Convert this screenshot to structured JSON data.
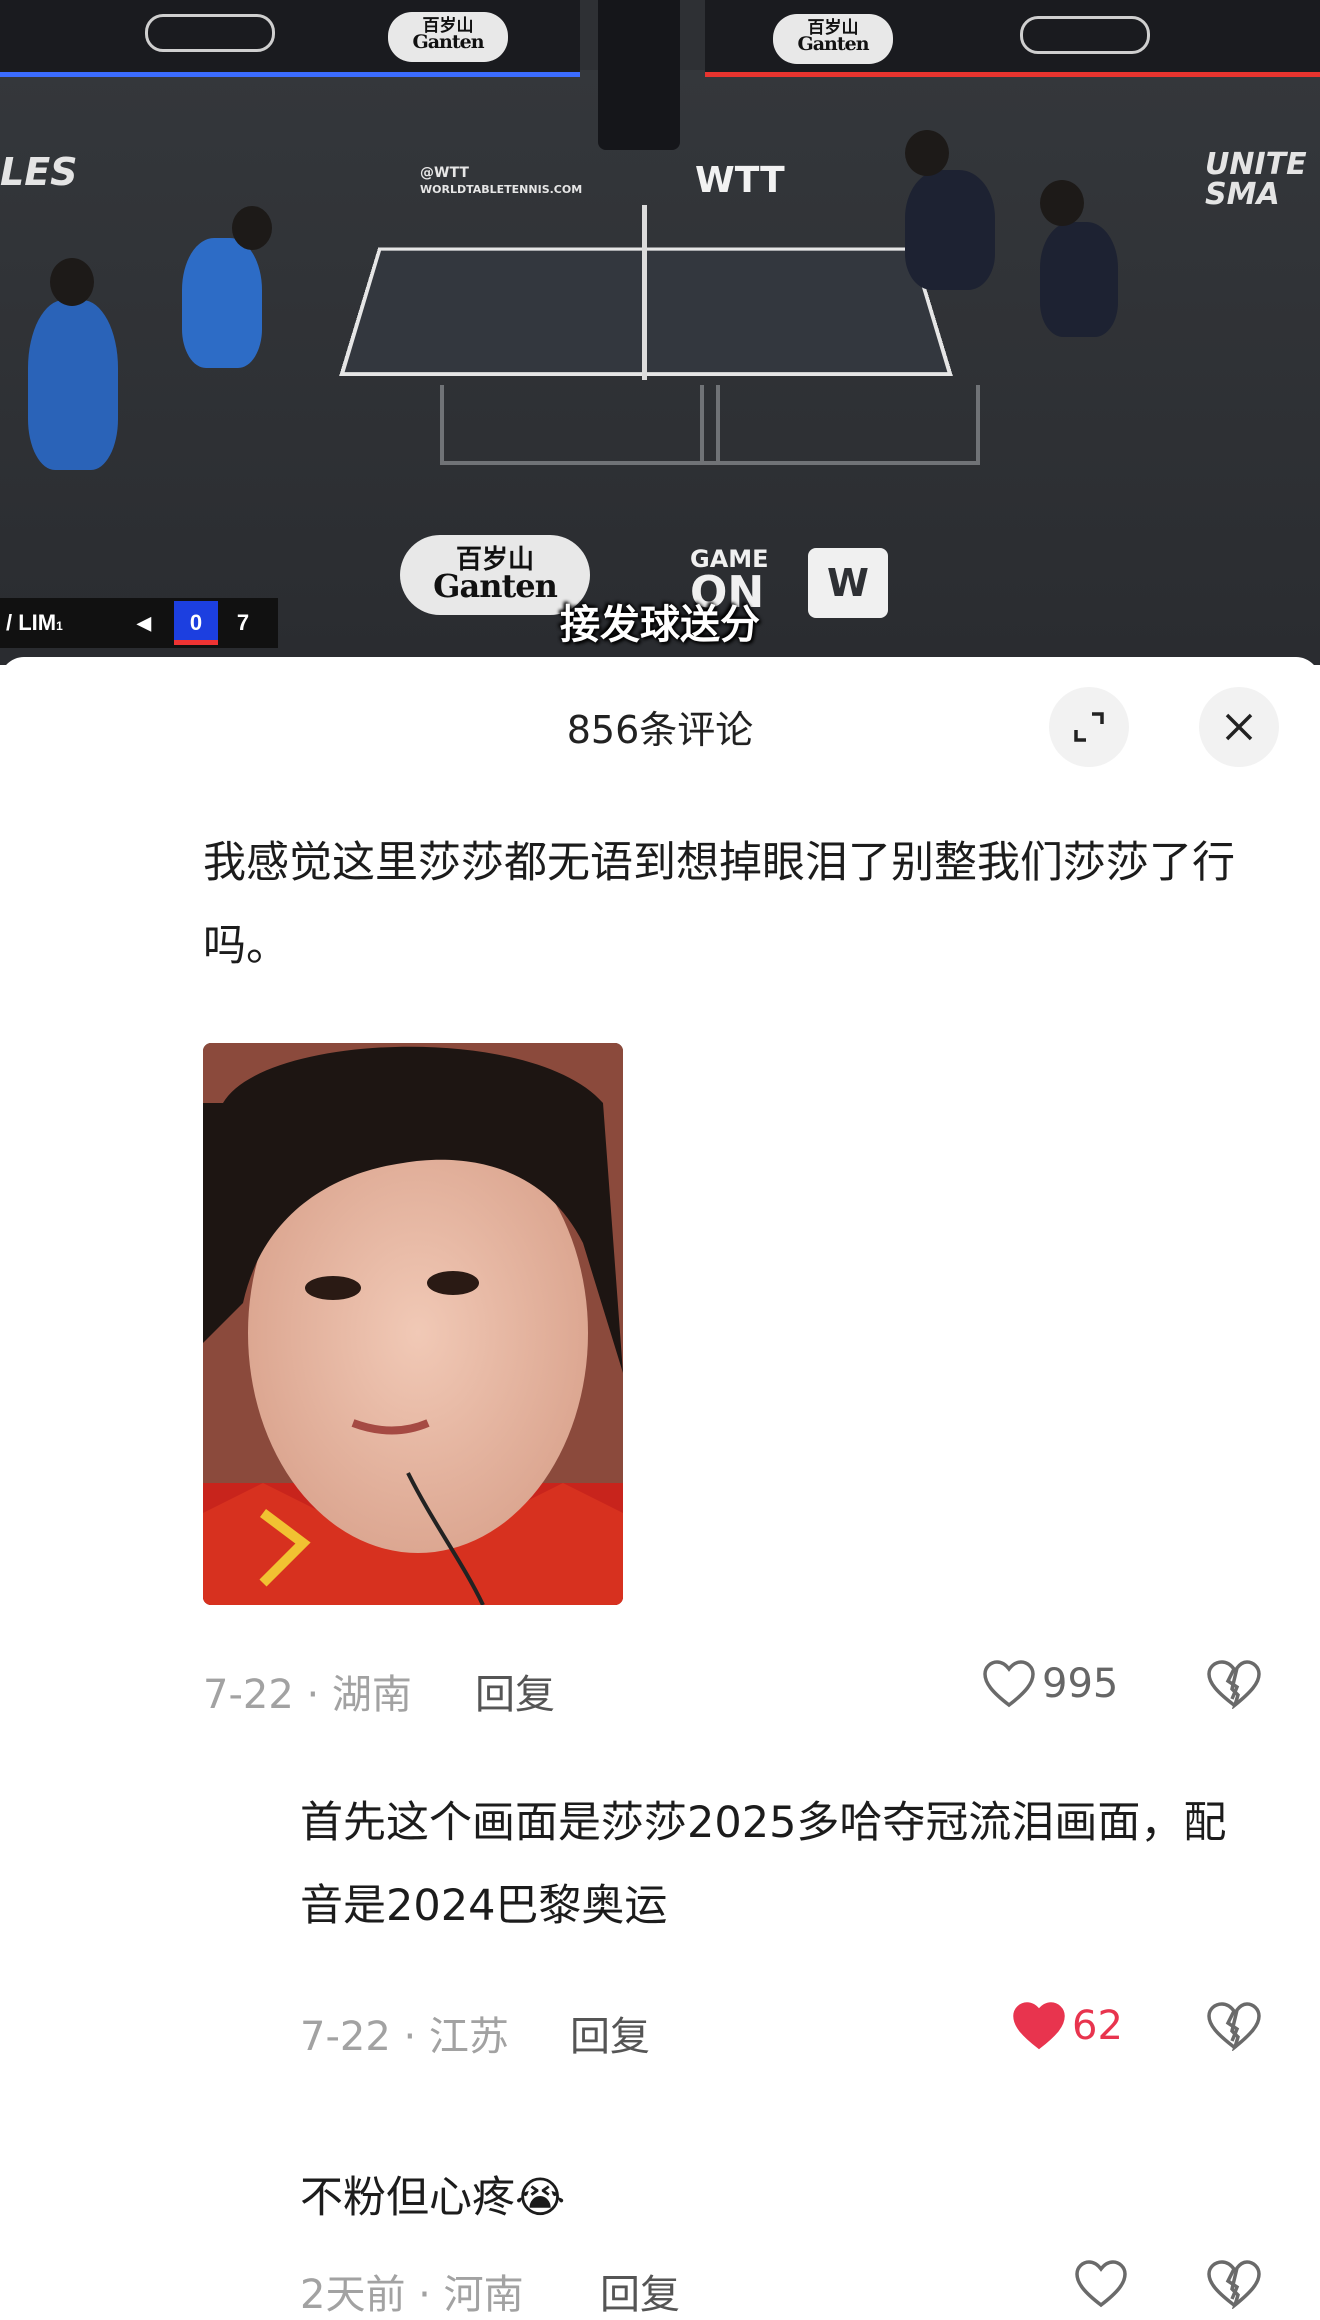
{
  "video": {
    "ad_brand_cn": "百岁山",
    "ad_brand_en": "Ganten",
    "wtt_handle": "@WTT",
    "wtt_site": "WORLDTABLETENNIS.COM",
    "wtt_logo": "WTT",
    "side_text_left": "LES",
    "side_text_right": "UNITE\nSMA",
    "game_on_top": "GAME",
    "game_on_bottom": "ON",
    "subtitle": "接发球送分",
    "scoreboard": {
      "team": "/ LIM",
      "team_sub": "1",
      "score_a": "0",
      "score_b": "7",
      "serve_icon": "serve-arrow-icon"
    }
  },
  "sheet": {
    "title": "856条评论",
    "expand_icon": "expand-icon",
    "close_icon": "close-icon"
  },
  "comments": [
    {
      "text": "我感觉这里莎莎都无语到想掉眼泪了别整我们莎莎了行吗。",
      "date_location": "7-22 · 湖南",
      "reply_label": "回复",
      "likes": "995",
      "liked": false
    },
    {
      "text": "首先这个画面是莎莎2025多哈夺冠流泪画面，配音是2024巴黎奥运",
      "date_location": "7-22 · 江苏",
      "reply_label": "回复",
      "likes": "62",
      "liked": true
    },
    {
      "text": "不粉但心疼😭",
      "date_location": "2天前 · 河南",
      "reply_label": "回复",
      "likes": "",
      "liked": false
    }
  ],
  "colors": {
    "liked": "#e8344e",
    "meta": "#a2a2a2",
    "sheet_bg": "#ffffff"
  }
}
